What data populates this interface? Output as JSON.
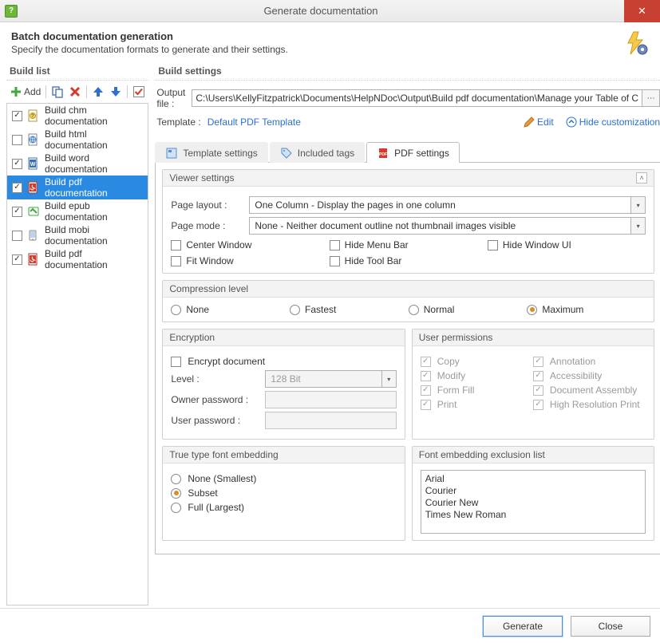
{
  "window": {
    "title": "Generate documentation"
  },
  "header": {
    "title": "Batch documentation generation",
    "subtitle": "Specify the documentation formats to generate and their settings."
  },
  "buildlist": {
    "title": "Build list",
    "add_label": "Add",
    "items": [
      {
        "checked": true,
        "label": "Build chm documentation",
        "selected": false,
        "kind": "chm"
      },
      {
        "checked": false,
        "label": "Build html documentation",
        "selected": false,
        "kind": "html"
      },
      {
        "checked": true,
        "label": "Build word documentation",
        "selected": false,
        "kind": "word"
      },
      {
        "checked": true,
        "label": "Build pdf documentation",
        "selected": true,
        "kind": "pdf"
      },
      {
        "checked": true,
        "label": "Build epub documentation",
        "selected": false,
        "kind": "epub"
      },
      {
        "checked": false,
        "label": "Build mobi documentation",
        "selected": false,
        "kind": "mobi"
      },
      {
        "checked": true,
        "label": "Build pdf documentation",
        "selected": false,
        "kind": "pdf"
      }
    ]
  },
  "settings": {
    "title": "Build settings",
    "output_label": "Output file :",
    "output_value": "C:\\Users\\KellyFitzpatrick\\Documents\\HelpNDoc\\Output\\Build pdf documentation\\Manage your Table of C",
    "template_label": "Template :",
    "template_value": "Default PDF Template",
    "edit_label": "Edit",
    "hide_label": "Hide customization"
  },
  "tabs": {
    "template": "Template settings",
    "included": "Included tags",
    "pdf": "PDF settings"
  },
  "viewer": {
    "title": "Viewer settings",
    "page_layout_label": "Page layout :",
    "page_layout_value": "One Column - Display the pages in one column",
    "page_mode_label": "Page mode :",
    "page_mode_value": "None - Neither document outline not thumbnail images visible",
    "center_window": "Center Window",
    "fit_window": "Fit Window",
    "hide_menu": "Hide Menu Bar",
    "hide_tool": "Hide Tool Bar",
    "hide_ui": "Hide Window UI"
  },
  "compression": {
    "title": "Compression level",
    "none": "None",
    "fastest": "Fastest",
    "normal": "Normal",
    "maximum": "Maximum",
    "selected": "maximum"
  },
  "encryption": {
    "title": "Encryption",
    "encrypt_doc": "Encrypt document",
    "level_label": "Level :",
    "level_value": "128 Bit",
    "owner_label": "Owner password :",
    "user_label": "User password :"
  },
  "permissions": {
    "title": "User permissions",
    "copy": "Copy",
    "modify": "Modify",
    "formfill": "Form Fill",
    "print": "Print",
    "annotation": "Annotation",
    "accessibility": "Accessibility",
    "assembly": "Document Assembly",
    "highres": "High Resolution Print"
  },
  "ttf": {
    "title": "True type font embedding",
    "none": "None (Smallest)",
    "subset": "Subset",
    "full": "Full (Largest)",
    "selected": "subset"
  },
  "fontlist": {
    "title": "Font embedding exclusion list",
    "items": [
      "Arial",
      "Courier",
      "Courier New",
      "Times New Roman"
    ]
  },
  "footer": {
    "generate": "Generate",
    "close": "Close"
  }
}
